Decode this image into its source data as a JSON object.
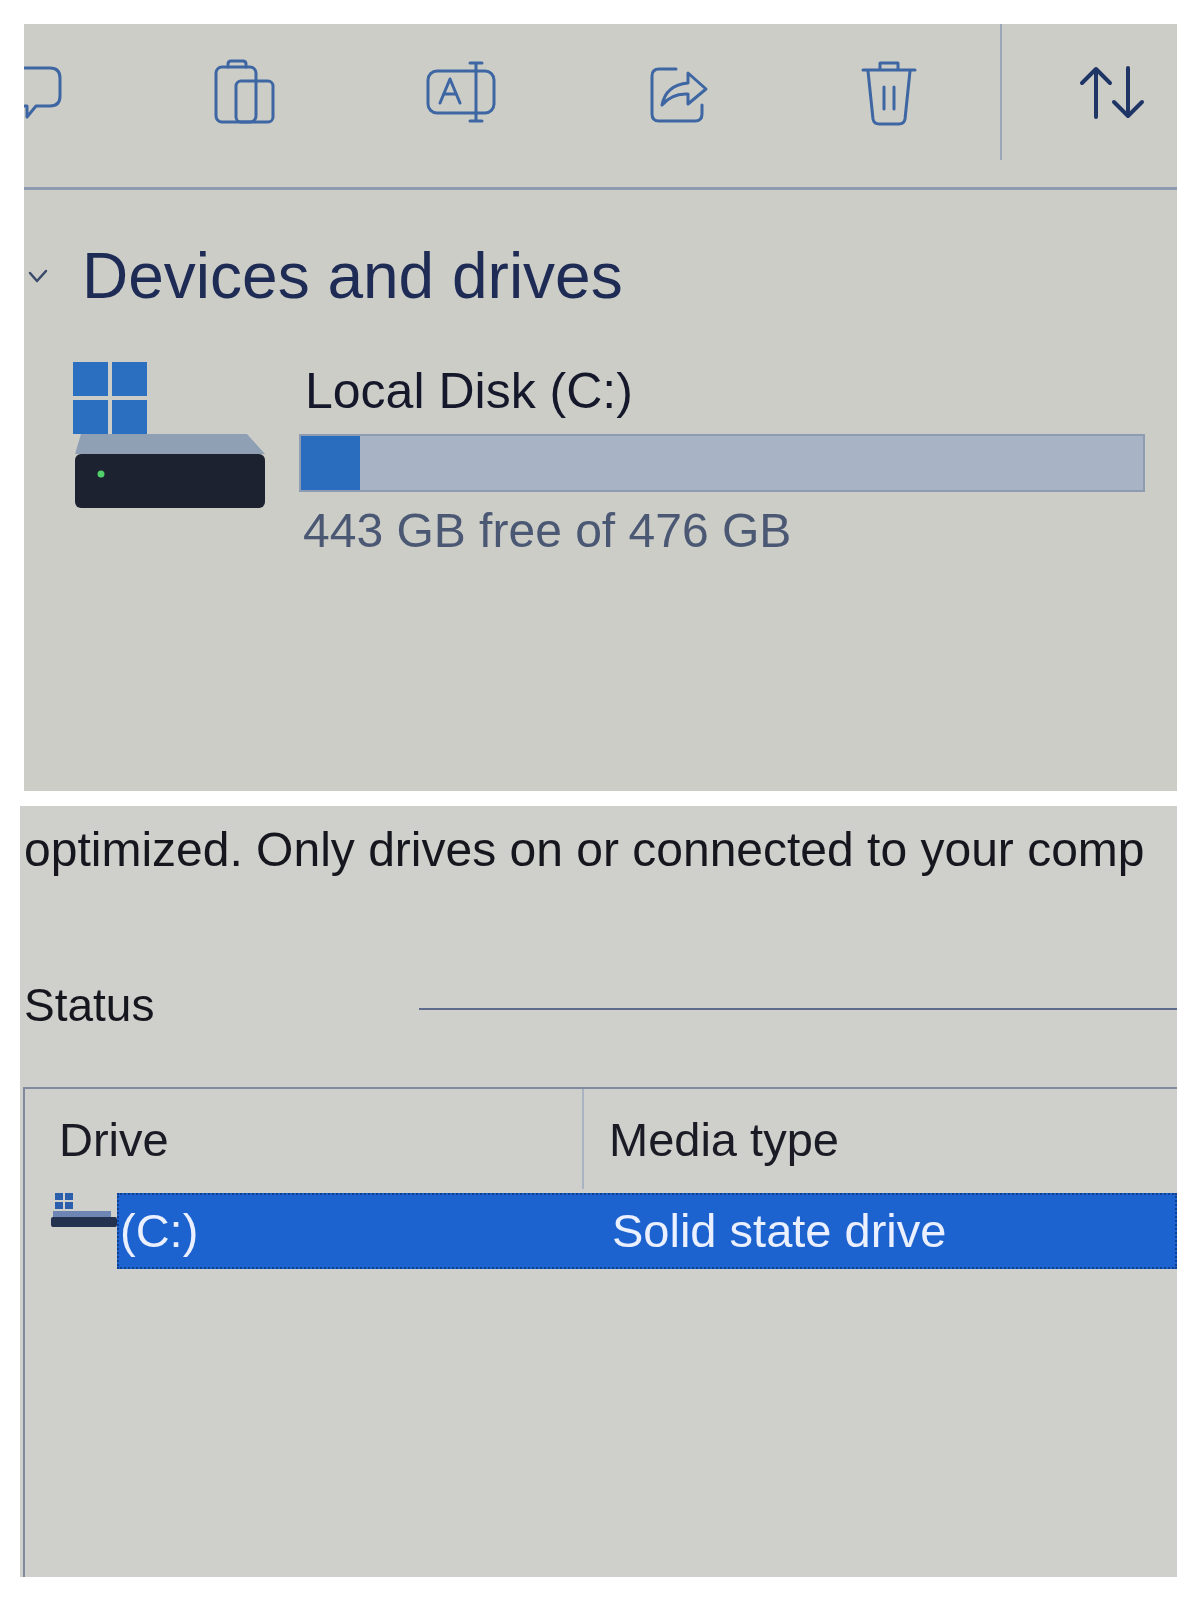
{
  "explorer": {
    "section": {
      "title": "Devices and drives",
      "expanded": true
    },
    "drives": [
      {
        "name": "Local Disk (C:)",
        "level": 0.07,
        "space": "443 GB free of 476 GB"
      }
    ]
  },
  "optimize_dialog": {
    "description": "optimized. Only drives on or connected to your comp",
    "status_label": "Status",
    "table": {
      "columns": [
        "Drive",
        "Media type"
      ],
      "rows": [
        {
          "drive": "(C:)",
          "media_type": "Solid state drive",
          "selected": true
        }
      ]
    }
  }
}
